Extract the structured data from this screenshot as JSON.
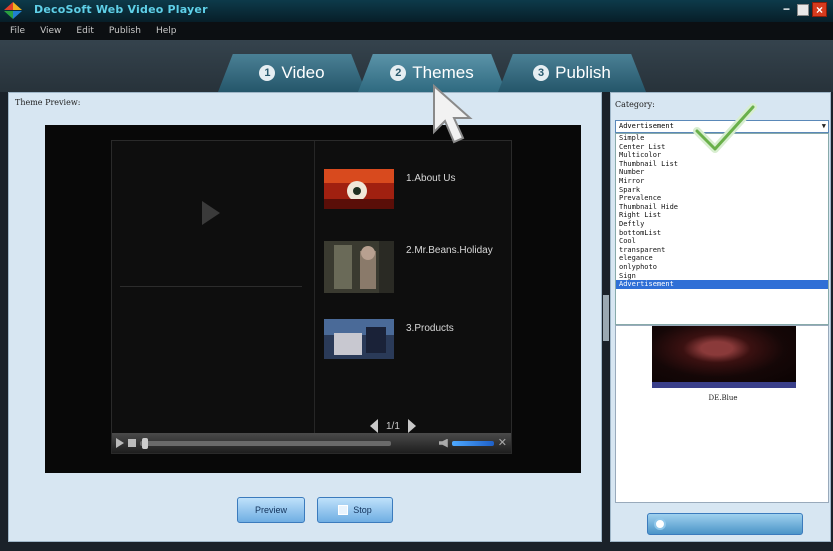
{
  "app": {
    "title": "DecoSoft Web Video Player"
  },
  "window_controls": {
    "minimize": "−",
    "close": "×"
  },
  "menu": [
    "File",
    "View",
    "Edit",
    "Publish",
    "Help"
  ],
  "tabs": [
    {
      "num": "1",
      "label": "Video",
      "active": false
    },
    {
      "num": "2",
      "label": "Themes",
      "active": true
    },
    {
      "num": "3",
      "label": "Publish",
      "active": false
    }
  ],
  "theme_preview": {
    "label": "Theme Preview:",
    "playlist": [
      {
        "label": "1.About Us",
        "thumb": "red-tinted clip"
      },
      {
        "label": "2.Mr.Beans.Holiday",
        "thumb": "dark scene clip"
      },
      {
        "label": "3.Products",
        "thumb": "blue scene clip"
      }
    ],
    "pager": "1/1"
  },
  "buttons": {
    "preview": "Preview",
    "stop": "Stop"
  },
  "category": {
    "label": "Category:",
    "selected": "Advertisement",
    "options": [
      "Simple",
      "Center List",
      "Multicolor",
      "Thumbnail List",
      "Number",
      "Mirror",
      "Spark",
      "Prevalence",
      "Thumbnail Hide",
      "Right List",
      "Deftly",
      "bottomList",
      "Cool",
      "transparent",
      "elegance",
      "onlyphoto",
      "Sign",
      "Advertisement"
    ],
    "thumb_caption": "DE.Blue"
  },
  "colors": {
    "accent": "#2f6fd6",
    "tab": "#3a7388",
    "panel": "#d7e6f2"
  }
}
